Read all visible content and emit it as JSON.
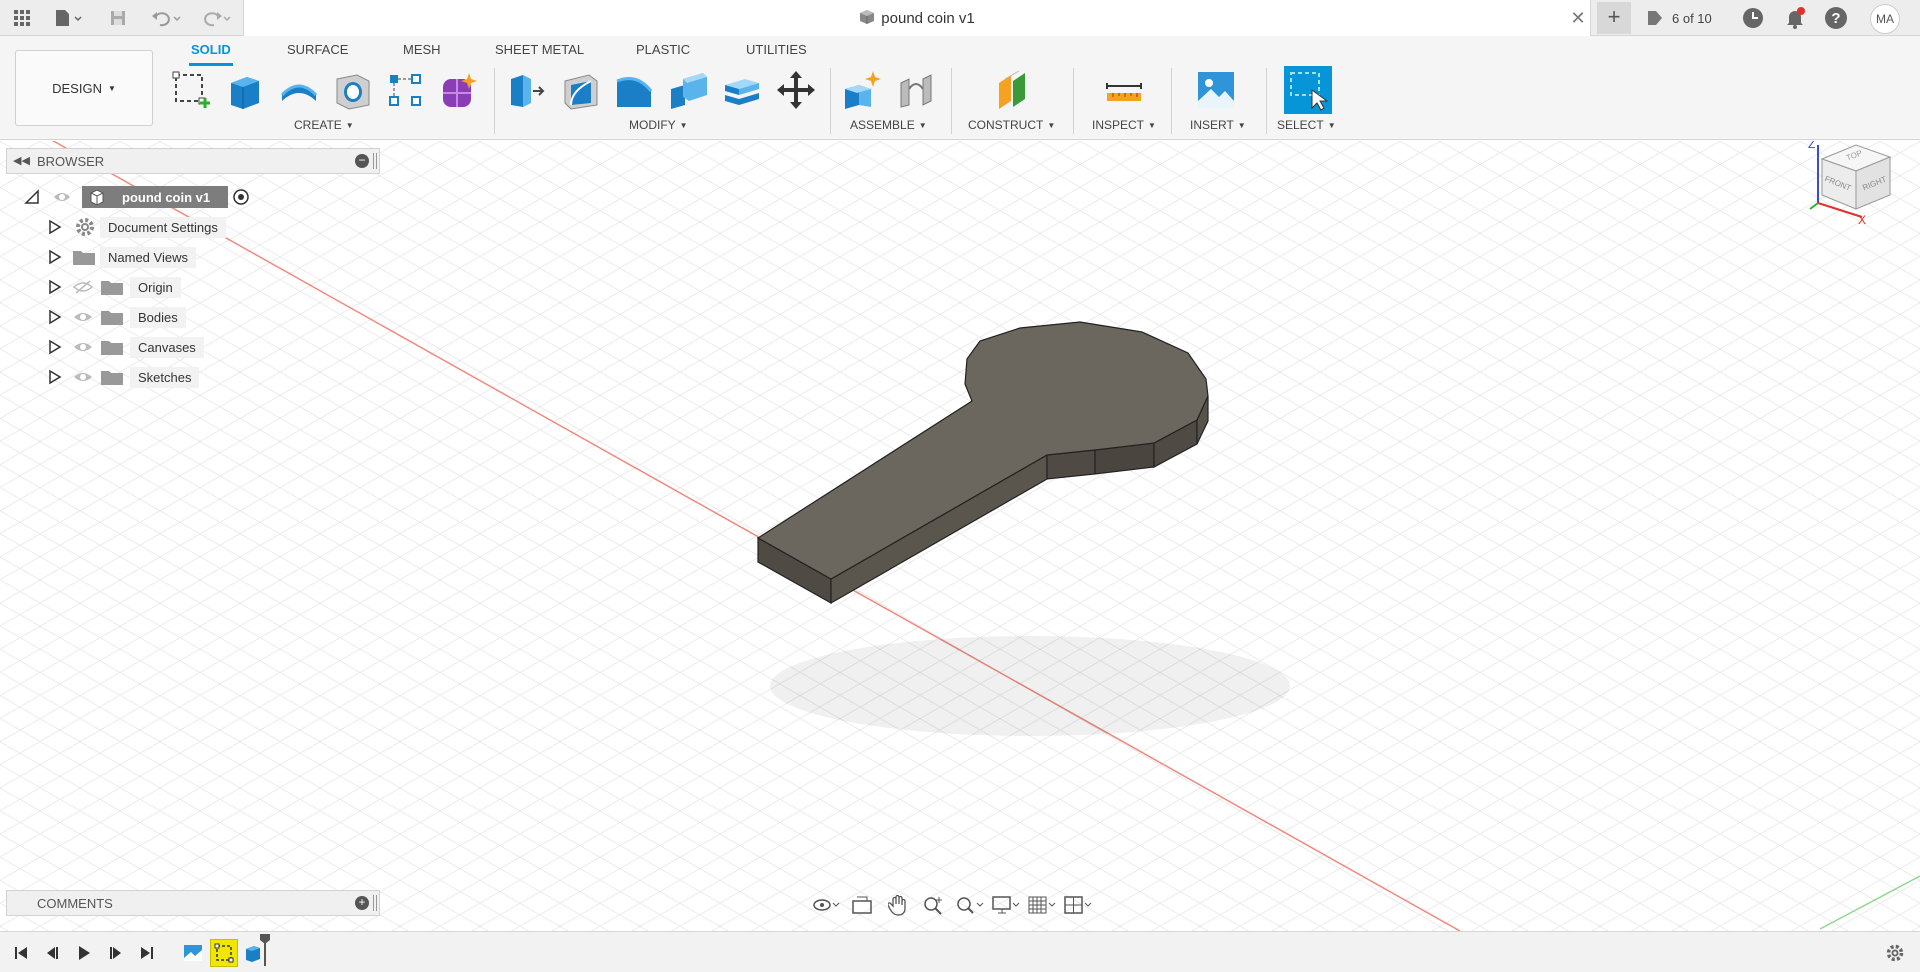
{
  "topbar": {
    "document_title": "pound coin v1",
    "jobs_status": "6 of 10",
    "user_initials": "MA"
  },
  "ribbon": {
    "workspace": "DESIGN",
    "tabs": [
      {
        "label": "SOLID",
        "active": true
      },
      {
        "label": "SURFACE",
        "active": false
      },
      {
        "label": "MESH",
        "active": false
      },
      {
        "label": "SHEET METAL",
        "active": false
      },
      {
        "label": "PLASTIC",
        "active": false
      },
      {
        "label": "UTILITIES",
        "active": false
      }
    ],
    "groups": {
      "create": "CREATE",
      "modify": "MODIFY",
      "assemble": "ASSEMBLE",
      "construct": "CONSTRUCT",
      "inspect": "INSPECT",
      "insert": "INSERT",
      "select": "SELECT"
    }
  },
  "browser": {
    "title": "BROWSER",
    "root": "pound coin v1",
    "items": [
      {
        "label": "Document Settings",
        "icon": "gear-icon",
        "visible": null
      },
      {
        "label": "Named Views",
        "icon": "folder-icon",
        "visible": null
      },
      {
        "label": "Origin",
        "icon": "folder-icon",
        "visible": false
      },
      {
        "label": "Bodies",
        "icon": "folder-icon",
        "visible": true
      },
      {
        "label": "Canvases",
        "icon": "folder-icon",
        "visible": true
      },
      {
        "label": "Sketches",
        "icon": "folder-icon",
        "visible": true
      }
    ]
  },
  "viewcube": {
    "top": "TOP",
    "front": "FRONT",
    "right": "RIGHT",
    "z_axis": "Z",
    "x_axis": "X"
  },
  "comments": {
    "title": "COMMENTS"
  },
  "colors": {
    "accent": "#0696d7",
    "model_top": "#6b665e",
    "model_side": "#4f4b44",
    "highlight": "#f1e600"
  }
}
